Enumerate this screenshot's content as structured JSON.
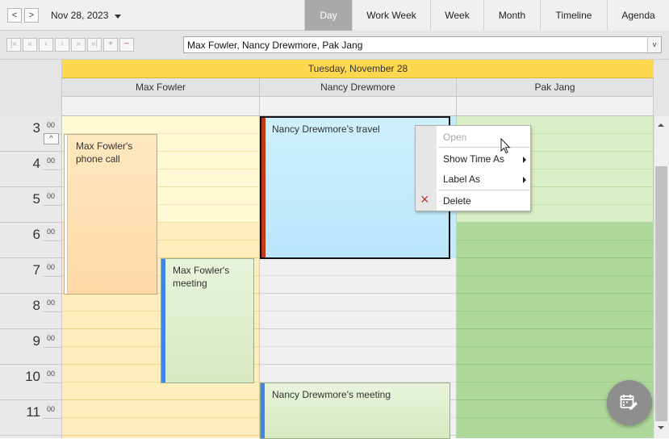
{
  "toolbar": {
    "date": "Nov 28, 2023",
    "prev_icon": "<",
    "next_icon": ">",
    "views": [
      {
        "label": "Day",
        "active": true
      },
      {
        "label": "Work Week",
        "active": false
      },
      {
        "label": "Week",
        "active": false
      },
      {
        "label": "Month",
        "active": false
      },
      {
        "label": "Timeline",
        "active": false
      },
      {
        "label": "Agenda",
        "active": false
      }
    ]
  },
  "resource_nav": {
    "buttons": [
      {
        "name": "first-icon",
        "glyph": "|«"
      },
      {
        "name": "prev-page-icon",
        "glyph": "«"
      },
      {
        "name": "prev-icon",
        "glyph": "‹"
      },
      {
        "name": "next-icon",
        "glyph": "›"
      },
      {
        "name": "next-page-icon",
        "glyph": "»"
      },
      {
        "name": "last-icon",
        "glyph": "»|"
      },
      {
        "name": "increase-icon",
        "glyph": "+"
      },
      {
        "name": "decrease-icon",
        "glyph": "−"
      }
    ],
    "selected_resources": "Max Fowler, Nancy Drewmore, Pak Jang",
    "dropdown_icon": "v"
  },
  "header": {
    "date_label": "Tuesday, November 28",
    "resources": [
      "Max Fowler",
      "Nancy Drewmore",
      "Pak Jang"
    ]
  },
  "time_ruler": {
    "hours": [
      "3",
      "4",
      "5",
      "6",
      "7",
      "8",
      "9",
      "10",
      "11"
    ],
    "minutes": "00",
    "more_icon": "^"
  },
  "appointments": {
    "phone_call": "Max Fowler's phone call",
    "max_meeting": "Max Fowler's meeting",
    "travel": "Nancy Drewmore's travel",
    "nancy_meeting": "Nancy Drewmore's meeting"
  },
  "context_menu": {
    "open": "Open",
    "show_time_as": "Show Time As",
    "label_as": "Label As",
    "delete": "Delete",
    "delete_icon": "×"
  },
  "colors": {
    "active_view": "#a9a9a9",
    "date_header": "#ffd84f",
    "max_fowler_work": "#fff9d6",
    "max_fowler_off": "#ffeebb",
    "nancy_work": "#f0f0f0",
    "pak_jang_work": "#d9eec6",
    "pak_jang_off": "#aed79a",
    "travel": "#c5ebfb",
    "meeting": "#e3f0d0",
    "phone_call": "#ffe4b6"
  }
}
